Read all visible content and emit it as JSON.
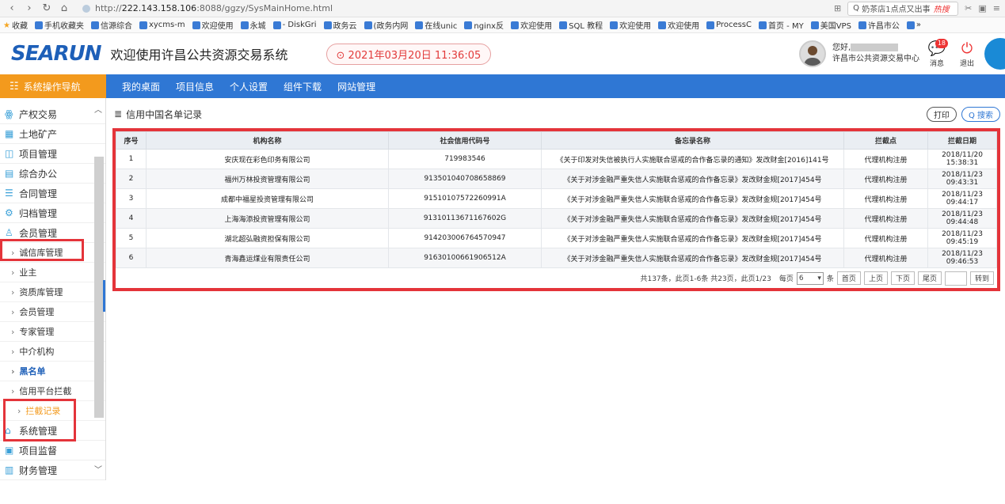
{
  "browser": {
    "url_prefix": "http://",
    "url_host": "222.143.158.106",
    "url_rest": ":8088/ggzy/SysMainHome.html",
    "search_text": "奶茶店1点点又出事",
    "search_hot": "热搜"
  },
  "bookmarks": [
    "收藏",
    "手机收藏夹",
    "信源综合",
    "xycms-m",
    "欢迎使用",
    "永城",
    "- DiskGri",
    "政务云",
    "(政务内网",
    "在线unic",
    "nginx反",
    "欢迎使用",
    "SQL 教程",
    "欢迎使用",
    "欢迎使用",
    "ProcessC",
    "首页 - MY",
    "美国VPS",
    "许昌市公",
    "»"
  ],
  "header": {
    "logo": "SEARUN",
    "title": "欢迎使用许昌公共资源交易系统",
    "datetime": "⊙ 2021年03月20日 11:36:05",
    "greeting": "您好,",
    "org": "许昌市公共资源交易中心",
    "msg_label": "消息",
    "msg_badge": "18",
    "exit_label": "退出"
  },
  "nav": {
    "left": "系统操作导航",
    "tabs": [
      "我的桌面",
      "项目信息",
      "个人设置",
      "组件下载",
      "网站管理"
    ]
  },
  "sidebar": {
    "items": [
      {
        "label": "产权交易",
        "icon": "ꙮ"
      },
      {
        "label": "土地矿产",
        "icon": "▦"
      },
      {
        "label": "项目管理",
        "icon": "◫"
      },
      {
        "label": "综合办公",
        "icon": "▤"
      },
      {
        "label": "合同管理",
        "icon": "☰"
      },
      {
        "label": "归档管理",
        "icon": "⚙"
      },
      {
        "label": "会员管理",
        "icon": "♙"
      }
    ],
    "subs": [
      "诚信库管理",
      "业主",
      "资质库管理",
      "会员管理",
      "专家管理",
      "中介机构",
      "黑名单",
      "信用平台拦截",
      "拦截记录"
    ],
    "bottom": [
      {
        "label": "系统管理",
        "icon": "⌂"
      },
      {
        "label": "项目监督",
        "icon": "▣"
      },
      {
        "label": "财务管理",
        "icon": "▥"
      }
    ]
  },
  "panel": {
    "title": "信用中国名单记录",
    "print": "打印",
    "search": "Q 搜索"
  },
  "table": {
    "headers": [
      "序号",
      "机构名称",
      "社会信用代码号",
      "备忘录名称",
      "拦截点",
      "拦截日期"
    ],
    "rows": [
      [
        "1",
        "安庆现在彩色印务有限公司",
        "719983546",
        "《关于印发对失信被执行人实施联合惩戒的合作备忘录的通知》发改财金[2016]141号",
        "代理机构注册",
        "2018/11/20 15:38:31"
      ],
      [
        "2",
        "福州万林投资管理有限公司",
        "913501040708658869",
        "《关于对涉金融严重失信人实施联合惩戒的合作备忘录》发改财金规[2017]454号",
        "代理机构注册",
        "2018/11/23 09:43:31"
      ],
      [
        "3",
        "成都中福星投资管理有限公司",
        "91510107572260991A",
        "《关于对涉金融严重失信人实施联合惩戒的合作备忘录》发改财金规[2017]454号",
        "代理机构注册",
        "2018/11/23 09:44:17"
      ],
      [
        "4",
        "上海海添投资管理有限公司",
        "91310113671167602G",
        "《关于对涉金融严重失信人实施联合惩戒的合作备忘录》发改财金规[2017]454号",
        "代理机构注册",
        "2018/11/23 09:44:48"
      ],
      [
        "5",
        "湖北超弘融资担保有限公司",
        "914203006764570947",
        "《关于对涉金融严重失信人实施联合惩戒的合作备忘录》发改财金规[2017]454号",
        "代理机构注册",
        "2018/11/23 09:45:19"
      ],
      [
        "6",
        "青海鑫运煤业有限责任公司",
        "91630100661906512A",
        "《关于对涉金融严重失信人实施联合惩戒的合作备忘录》发改财金规[2017]454号",
        "代理机构注册",
        "2018/11/23 09:46:53"
      ]
    ]
  },
  "pager": {
    "summary": "共137条，此页1-6条 共23页，此页1/23",
    "per_page_label": "每页",
    "per_page": "6",
    "unit": "条",
    "first": "首页",
    "prev": "上页",
    "next": "下页",
    "last": "尾页",
    "go": "转到"
  },
  "colors": {
    "accent": "#2f77d4",
    "nav_left": "#f39a1d",
    "highlight": "#e4343a"
  }
}
